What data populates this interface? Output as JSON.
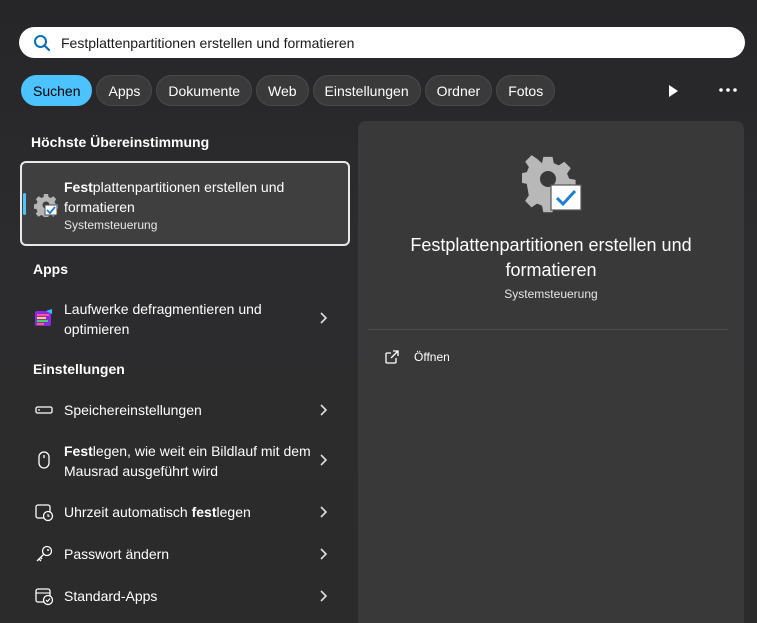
{
  "search": {
    "value": "Festplattenpartitionen erstellen und formatieren",
    "icon": "search-icon"
  },
  "filters": {
    "items": [
      "Suchen",
      "Apps",
      "Dokumente",
      "Web",
      "Einstellungen",
      "Ordner",
      "Fotos"
    ],
    "active": "Suchen",
    "accent": "#4cc2ff"
  },
  "left": {
    "best_match_title": "Höchste Übereinstimmung",
    "best_match": {
      "title_bold": "Fest",
      "title_rest": "plattenpartitionen erstellen und formatieren",
      "subtitle": "Systemsteuerung",
      "icon": "control-panel-gear-icon"
    },
    "apps_title": "Apps",
    "apps": [
      {
        "label": "Laufwerke defragmentieren und optimieren",
        "icon": "defrag-icon"
      }
    ],
    "settings_title": "Einstellungen",
    "settings": [
      {
        "pre": "",
        "bold": "",
        "post": "Speichereinstellungen",
        "icon": "storage-icon"
      },
      {
        "pre": "",
        "bold": "Fest",
        "post": "legen, wie weit ein Bildlauf mit dem Mausrad ausgeführt wird",
        "icon": "mouse-icon"
      },
      {
        "pre": "Uhrzeit automatisch ",
        "bold": "fest",
        "post": "legen",
        "icon": "clock-icon"
      },
      {
        "pre": "",
        "bold": "",
        "post": "Passwort ändern",
        "icon": "key-icon"
      },
      {
        "pre": "",
        "bold": "",
        "post": "Standard-Apps",
        "icon": "default-apps-icon"
      }
    ]
  },
  "preview": {
    "title": "Festplattenpartitionen erstellen und formatieren",
    "subtitle": "Systemsteuerung",
    "open_label": "Öffnen"
  }
}
